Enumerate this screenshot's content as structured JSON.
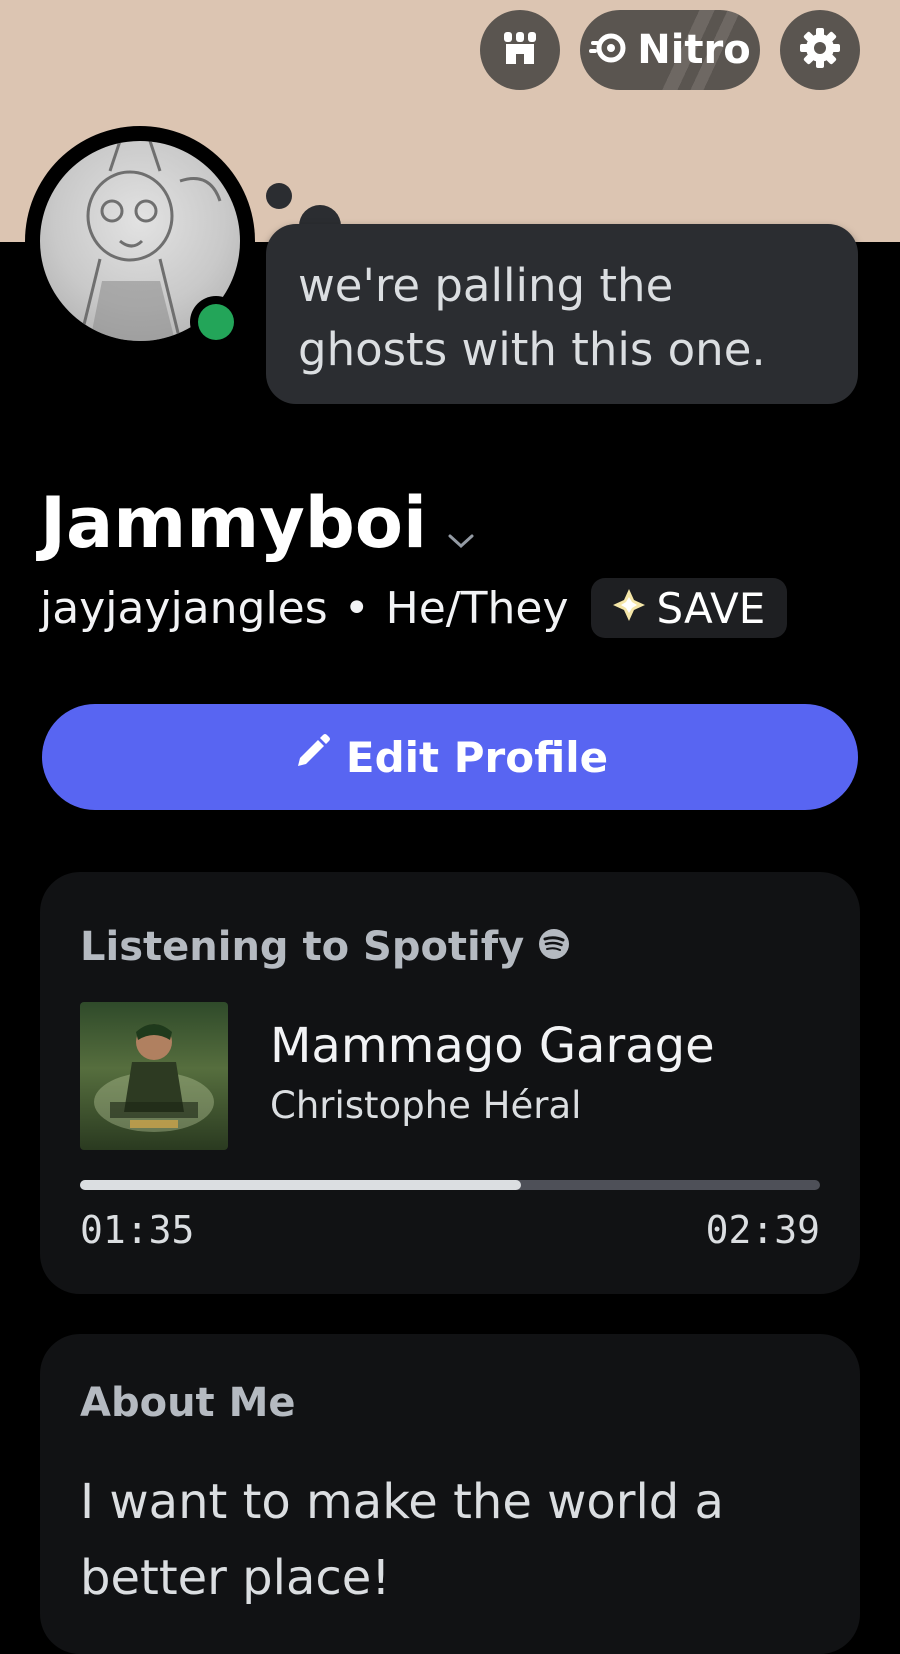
{
  "header": {
    "nitro_label": "Nitro"
  },
  "status_bubble": {
    "text": "we're palling the ghosts with this one."
  },
  "profile": {
    "display_name": "Jammyboi",
    "username": "jayjayjangles",
    "separator": "•",
    "pronouns": "He/They",
    "badge_label": "SAVE"
  },
  "edit_button": {
    "label": "Edit Profile"
  },
  "activity": {
    "heading": "Listening to Spotify",
    "track_title": "Mammago Garage",
    "artist": "Christophe Héral",
    "elapsed": "01:35",
    "total": "02:39",
    "progress_fraction": 0.596
  },
  "about": {
    "heading": "About Me",
    "text": "I want to make the world a better place!"
  },
  "colors": {
    "banner": "#dcc5b2",
    "accent": "#5865f2",
    "online": "#23a559",
    "card": "#111214"
  }
}
